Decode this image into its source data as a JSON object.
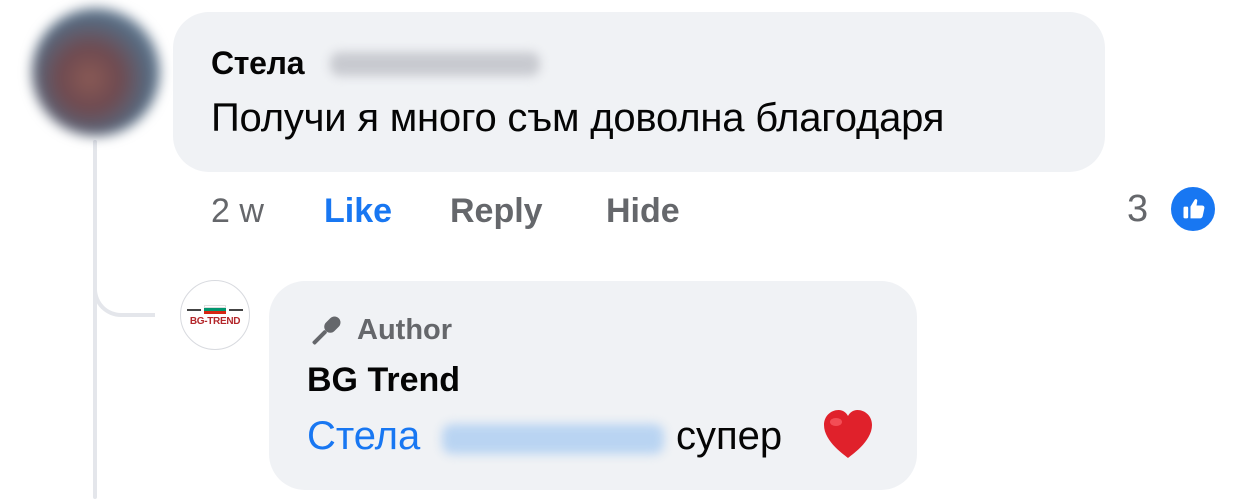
{
  "comment": {
    "author_first_name": "Стела",
    "text": "Получи я много съм доволна благодаря",
    "time": "2 w",
    "actions": {
      "like": "Like",
      "reply": "Reply",
      "hide": "Hide"
    },
    "reaction_count": "3",
    "reaction_icon": "thumbs-up-icon"
  },
  "reply": {
    "badge_label": "Author",
    "badge_icon": "microphone-icon",
    "page_logo_text": "BG-TREND",
    "author_name": "BG Trend",
    "mention_first_name": "Стела",
    "text": "супер",
    "emoji": "heart-emoji"
  },
  "colors": {
    "link_blue": "#1877f2",
    "bubble_bg": "#f0f2f5",
    "secondary_text": "#65676b"
  }
}
